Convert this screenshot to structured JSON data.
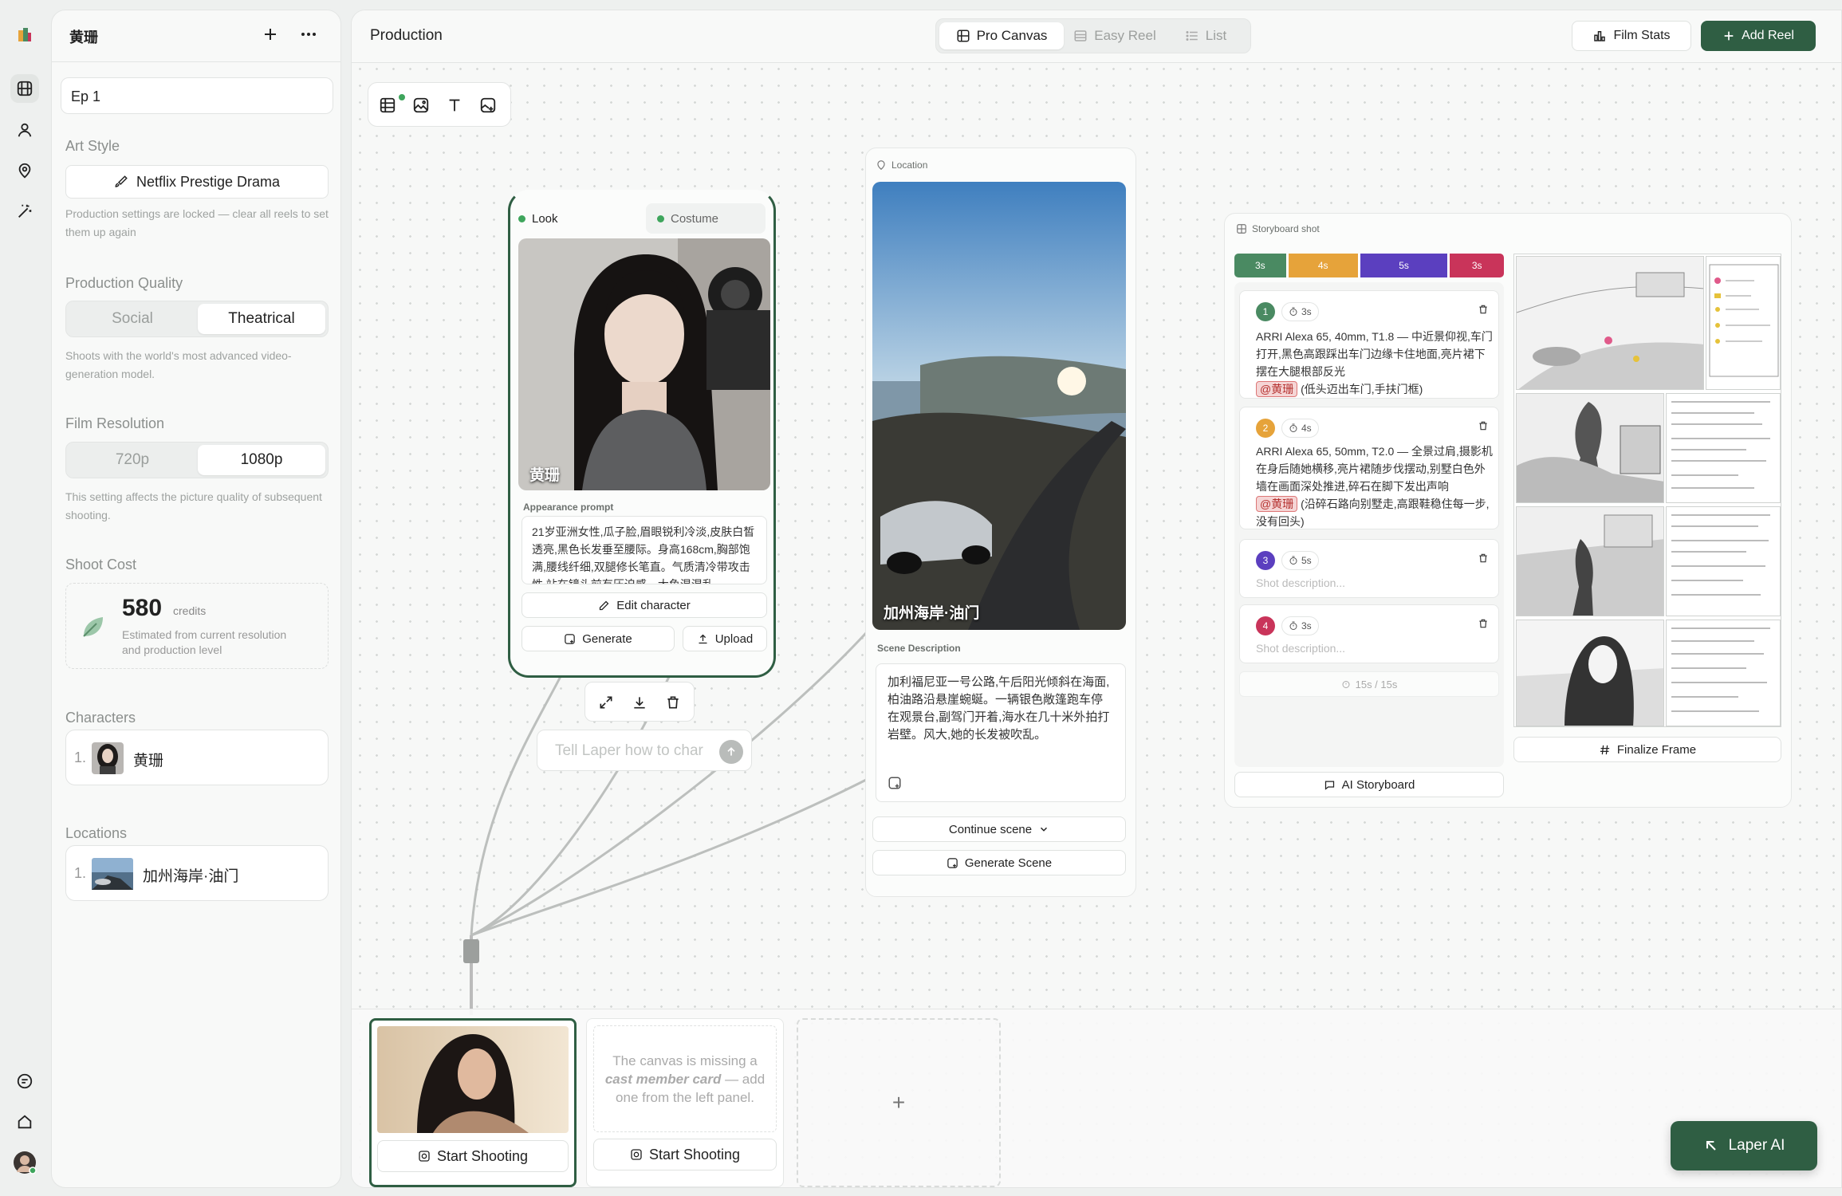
{
  "sidebar_rail": {
    "icons": [
      "logo",
      "reel-icon",
      "person-icon",
      "location-icon",
      "magic-icon",
      "chat-icon",
      "home-icon",
      "avatar"
    ]
  },
  "left_panel": {
    "project_name": "黄珊",
    "episode": "Ep 1",
    "art_style": {
      "label": "Art Style",
      "value": "Netflix Prestige Drama",
      "note": "Production settings are locked — clear all reels to set them up again"
    },
    "production_quality": {
      "label": "Production Quality",
      "options": [
        "Social",
        "Theatrical"
      ],
      "selected": "Theatrical",
      "note": "Shoots with the world's most advanced video-generation model."
    },
    "film_resolution": {
      "label": "Film Resolution",
      "options": [
        "720p",
        "1080p"
      ],
      "selected": "1080p",
      "note": "This setting affects the picture quality of subsequent shooting."
    },
    "shoot_cost": {
      "label": "Shoot Cost",
      "amount": "580",
      "unit": "credits",
      "note": "Estimated from current resolution and production level"
    },
    "characters": {
      "label": "Characters",
      "items": [
        {
          "index": "1.",
          "name": "黄珊"
        }
      ]
    },
    "locations": {
      "label": "Locations",
      "items": [
        {
          "index": "1.",
          "name": "加州海岸·油门"
        }
      ]
    }
  },
  "topbar": {
    "title": "Production",
    "view_tabs": [
      "Pro Canvas",
      "Easy Reel",
      "List"
    ],
    "active_view": "Pro Canvas",
    "film_stats": "Film Stats",
    "add_reel": "Add Reel"
  },
  "character_card": {
    "tabs": [
      "Look",
      "Costume"
    ],
    "name": "黄珊",
    "appearance_label": "Appearance prompt",
    "appearance_text": "21岁亚洲女性,瓜子脸,眉眼锐利冷淡,皮肤白皙透亮,黑色长发垂至腰际。身高168cm,胸部饱满,腰线纤细,双腿修长笔直。气质清冷带攻击性,站在镜头前有压迫感。大鱼混混乱",
    "edit_button": "Edit character",
    "generate_button": "Generate",
    "upload_button": "Upload",
    "prompt_placeholder": "Tell Laper how to char"
  },
  "location_card": {
    "header": "Location",
    "name": "加州海岸·油门",
    "scene_label": "Scene Description",
    "scene_text": "加利福尼亚一号公路,午后阳光倾斜在海面,柏油路沿悬崖蜿蜒。一辆银色敞篷跑车停在观景台,副驾门开着,海水在几十米外拍打岩壁。风大,她的长发被吹乱。",
    "continue_button": "Continue scene",
    "generate_button": "Generate Scene"
  },
  "storyboard_card": {
    "header": "Storyboard shot",
    "timeline": [
      {
        "label": "3s",
        "color": "#4a8a62"
      },
      {
        "label": "4s",
        "color": "#e6a33a"
      },
      {
        "label": "5s",
        "color": "#5b3fbf"
      },
      {
        "label": "3s",
        "color": "#c9345a"
      }
    ],
    "shots": [
      {
        "num": "1",
        "color": "#4a8a62",
        "duration": "3s",
        "text": "ARRI Alexa 65, 40mm, T1.8 — 中近景仰视,车门打开,黑色高跟踩出车门边缘卡住地面,亮片裙下摆在大腿根部反光",
        "tag": "@黄珊",
        "tail": "(低头迈出车门,手扶门框)"
      },
      {
        "num": "2",
        "color": "#e6a33a",
        "duration": "4s",
        "text": "ARRI Alexa 65, 50mm, T2.0 — 全景过肩,摄影机在身后随她横移,亮片裙随步伐摆动,别墅白色外墙在画面深处推进,碎石在脚下发出声响",
        "tag": "@黄珊",
        "tail": "(沿碎石路向别墅走,高跟鞋稳住每一步,没有回头)"
      },
      {
        "num": "3",
        "color": "#5b3fbf",
        "duration": "5s",
        "placeholder": "Shot description..."
      },
      {
        "num": "4",
        "color": "#c9345a",
        "duration": "3s",
        "placeholder": "Shot description..."
      }
    ],
    "total": "15s / 15s",
    "ai_button": "AI Storyboard",
    "finalize_button": "Finalize Frame"
  },
  "reel_strip": {
    "start_label": "Start Shooting",
    "missing_text": "The canvas is missing a cast member card — add one from the left panel.",
    "missing_pre": "The canvas is missing a ",
    "missing_em": "cast member card",
    "missing_post": " — add one from the left panel.",
    "add": "+"
  },
  "laper_ai": "Laper AI"
}
